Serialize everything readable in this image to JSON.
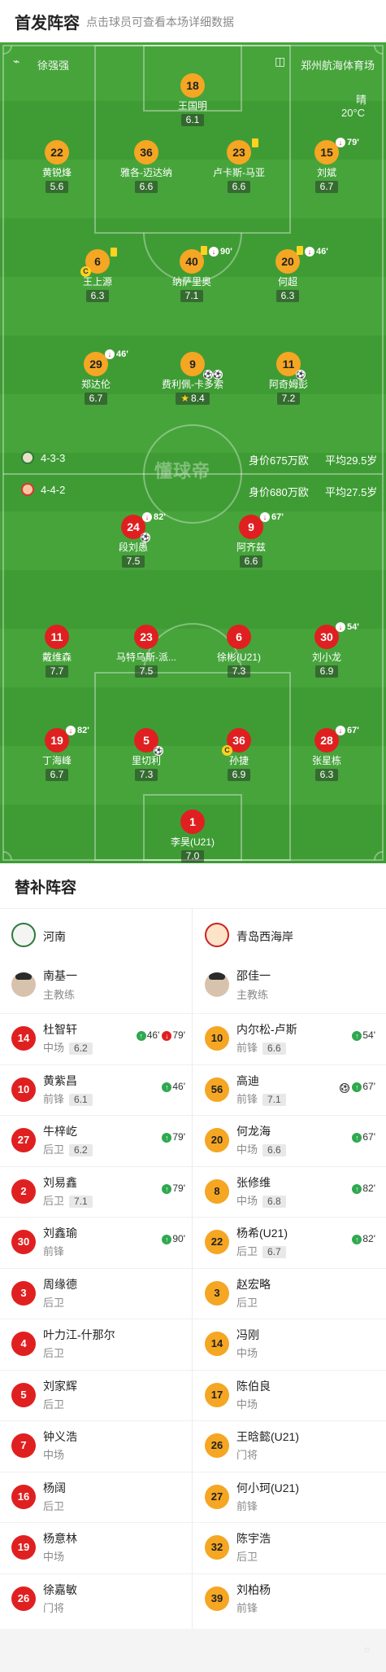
{
  "header": {
    "title": "首发阵容",
    "hint": "点击球员可查看本场详细数据"
  },
  "match": {
    "referee": "徐强强",
    "venue": "郑州航海体育场",
    "weather": "晴",
    "temperature": "20°C"
  },
  "home_lineup": [
    {
      "num": "1",
      "name": "李昊(U21)",
      "rating": "7.0"
    },
    {
      "num": "19",
      "name": "丁海峰",
      "rating": "6.7",
      "sub": "82'"
    },
    {
      "num": "5",
      "name": "里切利",
      "rating": "7.3",
      "goal": true
    },
    {
      "num": "36",
      "name": "孙捷",
      "rating": "6.9",
      "captain": true
    },
    {
      "num": "28",
      "name": "张星栋",
      "rating": "6.3",
      "sub": "67'"
    },
    {
      "num": "11",
      "name": "戴维森",
      "rating": "7.7"
    },
    {
      "num": "23",
      "name": "马特乌斯-派...",
      "rating": "7.5"
    },
    {
      "num": "6",
      "name": "徐彬(U21)",
      "rating": "7.3"
    },
    {
      "num": "30",
      "name": "刘小龙",
      "rating": "6.9",
      "sub": "54'"
    },
    {
      "num": "24",
      "name": "段刘愚",
      "rating": "7.5",
      "sub": "82'",
      "goal": true
    },
    {
      "num": "9",
      "name": "阿齐兹",
      "rating": "6.6",
      "sub": "67'"
    }
  ],
  "home_formation": {
    "formation": "4-4-2",
    "value": "身价680万欧",
    "avg_age": "平均27.5岁"
  },
  "away_formation": {
    "formation": "4-3-3",
    "value": "身价675万欧",
    "avg_age": "平均29.5岁"
  },
  "center_logo": "懂球帝",
  "away_lineup": [
    {
      "num": "18",
      "name": "王国明",
      "rating": "6.1"
    },
    {
      "num": "22",
      "name": "黄锐烽",
      "rating": "5.6"
    },
    {
      "num": "36",
      "name": "雅各-迈达纳",
      "rating": "6.6"
    },
    {
      "num": "23",
      "name": "卢卡斯-马亚",
      "rating": "6.6",
      "yellow": true
    },
    {
      "num": "15",
      "name": "刘斌",
      "rating": "6.7",
      "sub": "79'"
    },
    {
      "num": "6",
      "name": "王上源",
      "rating": "6.3",
      "yellow": true,
      "captain": true
    },
    {
      "num": "40",
      "name": "纳萨里奥",
      "rating": "7.1",
      "yellow_sub": "90'"
    },
    {
      "num": "20",
      "name": "何超",
      "rating": "6.3",
      "yellow_sub": "46'"
    },
    {
      "num": "29",
      "name": "郑达伦",
      "rating": "6.7",
      "sub": "46'"
    },
    {
      "num": "9",
      "name": "费利佩-卡多索",
      "rating": "8.4",
      "star": true,
      "goal2": true
    },
    {
      "num": "11",
      "name": "阿奇姆彭",
      "rating": "7.2",
      "goal": true
    }
  ],
  "subs": {
    "title": "替补阵容",
    "home_team": "河南",
    "away_team": "青岛西海岸",
    "home_coach": {
      "name": "南基一",
      "role": "主教练"
    },
    "away_coach": {
      "name": "邵佳一",
      "role": "主教练"
    },
    "home": [
      {
        "num": "14",
        "name": "杜智轩",
        "pos": "中场",
        "rating": "6.2",
        "events": [
          "up:46'",
          "down:79'"
        ]
      },
      {
        "num": "10",
        "name": "黄紫昌",
        "pos": "前锋",
        "rating": "6.1",
        "events": [
          "up:46'"
        ]
      },
      {
        "num": "27",
        "name": "牛梓屹",
        "pos": "后卫",
        "rating": "6.2",
        "events": [
          "up:79'"
        ]
      },
      {
        "num": "2",
        "name": "刘易鑫",
        "pos": "后卫",
        "rating": "7.1",
        "events": [
          "up:79'"
        ]
      },
      {
        "num": "30",
        "name": "刘鑫瑜",
        "pos": "前锋",
        "rating": "",
        "events": [
          "up:90'"
        ]
      },
      {
        "num": "3",
        "name": "周缘德",
        "pos": "后卫",
        "rating": "",
        "events": []
      },
      {
        "num": "4",
        "name": "叶力江-什那尔",
        "pos": "后卫",
        "rating": "",
        "events": []
      },
      {
        "num": "5",
        "name": "刘家辉",
        "pos": "后卫",
        "rating": "",
        "events": []
      },
      {
        "num": "7",
        "name": "钟义浩",
        "pos": "中场",
        "rating": "",
        "events": []
      },
      {
        "num": "16",
        "name": "杨阔",
        "pos": "后卫",
        "rating": "",
        "events": []
      },
      {
        "num": "19",
        "name": "杨意林",
        "pos": "中场",
        "rating": "",
        "events": []
      },
      {
        "num": "26",
        "name": "徐嘉敏",
        "pos": "门将",
        "rating": "",
        "events": []
      }
    ],
    "away": [
      {
        "num": "10",
        "name": "内尔松-卢斯",
        "pos": "前锋",
        "rating": "6.6",
        "events": [
          "up:54'"
        ]
      },
      {
        "num": "56",
        "name": "高迪",
        "pos": "前锋",
        "rating": "7.1",
        "events": [
          "goal",
          "up:67'"
        ]
      },
      {
        "num": "20",
        "name": "何龙海",
        "pos": "中场",
        "rating": "6.6",
        "events": [
          "up:67'"
        ]
      },
      {
        "num": "8",
        "name": "张修维",
        "pos": "中场",
        "rating": "6.8",
        "events": [
          "up:82'"
        ]
      },
      {
        "num": "22",
        "name": "杨希(U21)",
        "pos": "后卫",
        "rating": "6.7",
        "events": [
          "up:82'"
        ]
      },
      {
        "num": "3",
        "name": "赵宏略",
        "pos": "后卫",
        "rating": "",
        "events": []
      },
      {
        "num": "14",
        "name": "冯刚",
        "pos": "中场",
        "rating": "",
        "events": []
      },
      {
        "num": "17",
        "name": "陈伯良",
        "pos": "中场",
        "rating": "",
        "events": []
      },
      {
        "num": "26",
        "name": "王晗懿(U21)",
        "pos": "门将",
        "rating": "",
        "events": []
      },
      {
        "num": "27",
        "name": "何小珂(U21)",
        "pos": "前锋",
        "rating": "",
        "events": []
      },
      {
        "num": "32",
        "name": "陈宇浩",
        "pos": "后卫",
        "rating": "",
        "events": []
      },
      {
        "num": "39",
        "name": "刘柏杨",
        "pos": "前锋",
        "rating": "",
        "events": []
      }
    ]
  },
  "colors": {
    "home": "#e02020",
    "away": "#f5a623",
    "pitch": "#3f9c35",
    "sub_in": "#2fa84f"
  }
}
